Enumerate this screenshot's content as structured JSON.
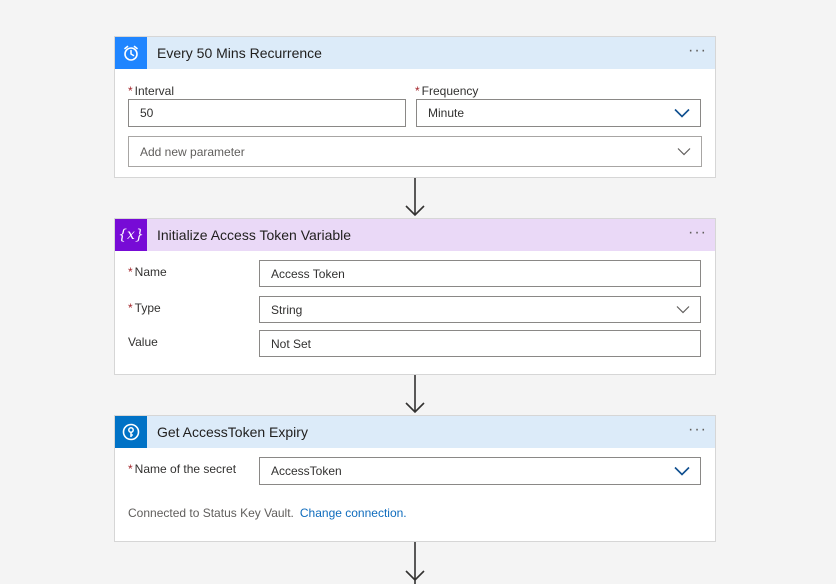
{
  "cards": [
    {
      "title": "Every 50 Mins Recurrence",
      "icon": "alarm-clock-icon",
      "header_color": "#dcebf9",
      "icon_bg": "#1f85ff",
      "fields": {
        "interval_label": "Interval",
        "interval_value": "50",
        "frequency_label": "Frequency",
        "frequency_value": "Minute",
        "add_param_placeholder": "Add new parameter"
      }
    },
    {
      "title": "Initialize Access Token Variable",
      "icon": "variable-icon",
      "icon_glyph": "{x}",
      "header_color": "#ead9f7",
      "icon_bg": "#770bd6",
      "fields": {
        "name_label": "Name",
        "name_value": "Access Token",
        "type_label": "Type",
        "type_value": "String",
        "value_label": "Value",
        "value_value": "Not Set"
      }
    },
    {
      "title": "Get AccessToken Expiry",
      "icon": "key-vault-icon",
      "header_color": "#dcebf9",
      "icon_bg": "#0072c6",
      "fields": {
        "secret_label": "Name of the secret",
        "secret_value": "AccessToken",
        "connection_text": "Connected to Status Key Vault.",
        "change_connection": "Change connection."
      }
    }
  ],
  "more_glyph": "···",
  "required_mark": "*"
}
